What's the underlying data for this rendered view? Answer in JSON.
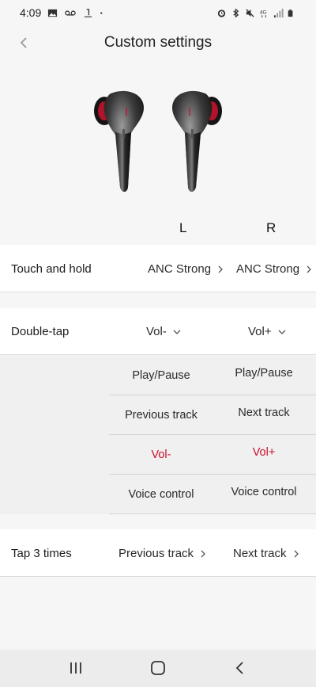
{
  "status_bar": {
    "time": "4:09",
    "left_icons": [
      "image-icon",
      "voicemail-icon",
      "signal-app-icon",
      "dot-icon"
    ],
    "right_icons": [
      "alarm-icon",
      "bluetooth-icon",
      "mute-icon",
      "4g-icon",
      "signal-bars-icon",
      "battery-icon"
    ]
  },
  "header": {
    "title": "Custom settings",
    "back_icon": "chevron-left-icon"
  },
  "earbuds": {
    "left_label": "L",
    "right_label": "R"
  },
  "touch_and_hold": {
    "label": "Touch and hold",
    "left_value": "ANC Strong",
    "right_value": "ANC Strong"
  },
  "double_tap": {
    "label": "Double-tap",
    "left_value": "Vol-",
    "right_value": "Vol+",
    "left_options": [
      "Play/Pause",
      "Previous track",
      "Vol-",
      "Voice control"
    ],
    "right_options": [
      "Play/Pause",
      "Next track",
      "Vol+",
      "Voice control"
    ],
    "selected_color": "#c8102e"
  },
  "tap_3_times": {
    "label": "Tap 3 times",
    "left_value": "Previous track",
    "right_value": "Next track"
  },
  "nav": {
    "recents": "recents-icon",
    "home": "home-icon",
    "back": "back-icon"
  }
}
